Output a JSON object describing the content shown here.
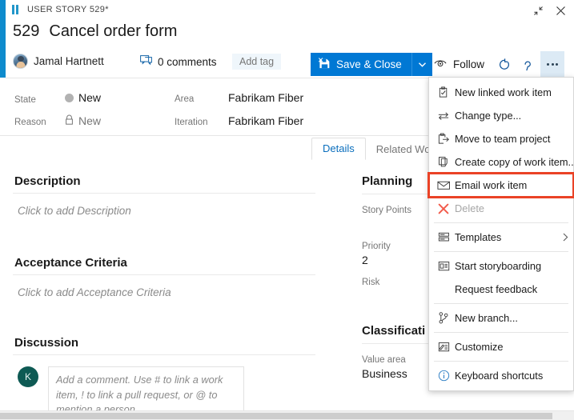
{
  "window": {
    "type_label": "USER STORY 529*",
    "type_icon": "work-item-icon",
    "restore_icon": "restore-down-icon",
    "close_icon": "close-icon"
  },
  "header": {
    "id": "529",
    "title": "Cancel order form",
    "author": "Jamal Hartnett",
    "comments_label": "0 comments",
    "comments_icon": "comment-icon",
    "add_tag_label": "Add tag"
  },
  "toolbar": {
    "save_close_label": "Save & Close",
    "save_icon": "save-icon",
    "save_caret_icon": "chevron-down-icon",
    "follow_label": "Follow",
    "follow_icon": "eye-icon",
    "refresh_icon": "refresh-icon",
    "revert_icon": "undo-icon",
    "more_icon": "more-actions-icon"
  },
  "fields": [
    {
      "label": "State",
      "value": "New",
      "icon": "state-dot"
    },
    {
      "label": "Reason",
      "value": "New",
      "icon": "lock-icon"
    },
    {
      "label": "Area",
      "value": "Fabrikam Fiber",
      "icon": ""
    },
    {
      "label": "Iteration",
      "value": "Fabrikam Fiber",
      "icon": ""
    }
  ],
  "tabs": [
    {
      "label": "Details",
      "active": true
    },
    {
      "label": "Related Work it",
      "active": false
    }
  ],
  "sections": {
    "description": {
      "title": "Description",
      "placeholder": "Click to add Description"
    },
    "acceptance": {
      "title": "Acceptance Criteria",
      "placeholder": "Click to add Acceptance Criteria"
    },
    "discussion": {
      "title": "Discussion",
      "avatar_initial": "K",
      "placeholder": "Add a comment. Use # to link a work item, ! to link a pull request, or @ to mention a person."
    }
  },
  "planning": {
    "title": "Planning",
    "story_points_label": "Story Points",
    "story_points_value": "",
    "priority_label": "Priority",
    "priority_value": "2",
    "risk_label": "Risk"
  },
  "classification": {
    "title": "Classificati",
    "value_area_label": "Value area",
    "value_area_value": "Business"
  },
  "context_menu": {
    "items": [
      {
        "id": "new-linked-work-item",
        "label": "New linked work item",
        "icon": "linked-work-item-icon",
        "disabled": false,
        "submenu": false,
        "highlight": false,
        "separator_after": false
      },
      {
        "id": "change-type",
        "label": "Change type...",
        "icon": "change-type-icon",
        "disabled": false,
        "submenu": false,
        "highlight": false,
        "separator_after": false
      },
      {
        "id": "move-to-team-project",
        "label": "Move to team project",
        "icon": "move-icon",
        "disabled": false,
        "submenu": false,
        "highlight": false,
        "separator_after": false
      },
      {
        "id": "create-copy",
        "label": "Create copy of work item...",
        "icon": "copy-icon",
        "disabled": false,
        "submenu": false,
        "highlight": false,
        "separator_after": false
      },
      {
        "id": "email-work-item",
        "label": "Email work item",
        "icon": "email-icon",
        "disabled": false,
        "submenu": false,
        "highlight": true,
        "separator_after": false
      },
      {
        "id": "delete",
        "label": "Delete",
        "icon": "delete-icon",
        "disabled": true,
        "submenu": false,
        "highlight": false,
        "separator_after": true
      },
      {
        "id": "templates",
        "label": "Templates",
        "icon": "templates-icon",
        "disabled": false,
        "submenu": true,
        "highlight": false,
        "separator_after": true
      },
      {
        "id": "start-storyboarding",
        "label": "Start storyboarding",
        "icon": "storyboard-icon",
        "disabled": false,
        "submenu": false,
        "highlight": false,
        "separator_after": false
      },
      {
        "id": "request-feedback",
        "label": "Request feedback",
        "icon": "",
        "disabled": false,
        "submenu": false,
        "highlight": false,
        "separator_after": true
      },
      {
        "id": "new-branch",
        "label": "New branch...",
        "icon": "branch-icon",
        "disabled": false,
        "submenu": false,
        "highlight": false,
        "separator_after": true
      },
      {
        "id": "customize",
        "label": "Customize",
        "icon": "customize-icon",
        "disabled": false,
        "submenu": false,
        "highlight": false,
        "separator_after": true
      },
      {
        "id": "keyboard-shortcuts",
        "label": "Keyboard shortcuts",
        "icon": "info-icon",
        "disabled": false,
        "submenu": false,
        "highlight": false,
        "separator_after": false
      }
    ]
  },
  "colors": {
    "accent_blue": "#0e8bcd",
    "primary_button": "#0078d4",
    "highlight_red": "#ea4226",
    "tab_active": "#0a6ebd",
    "muted_text": "#767676"
  }
}
